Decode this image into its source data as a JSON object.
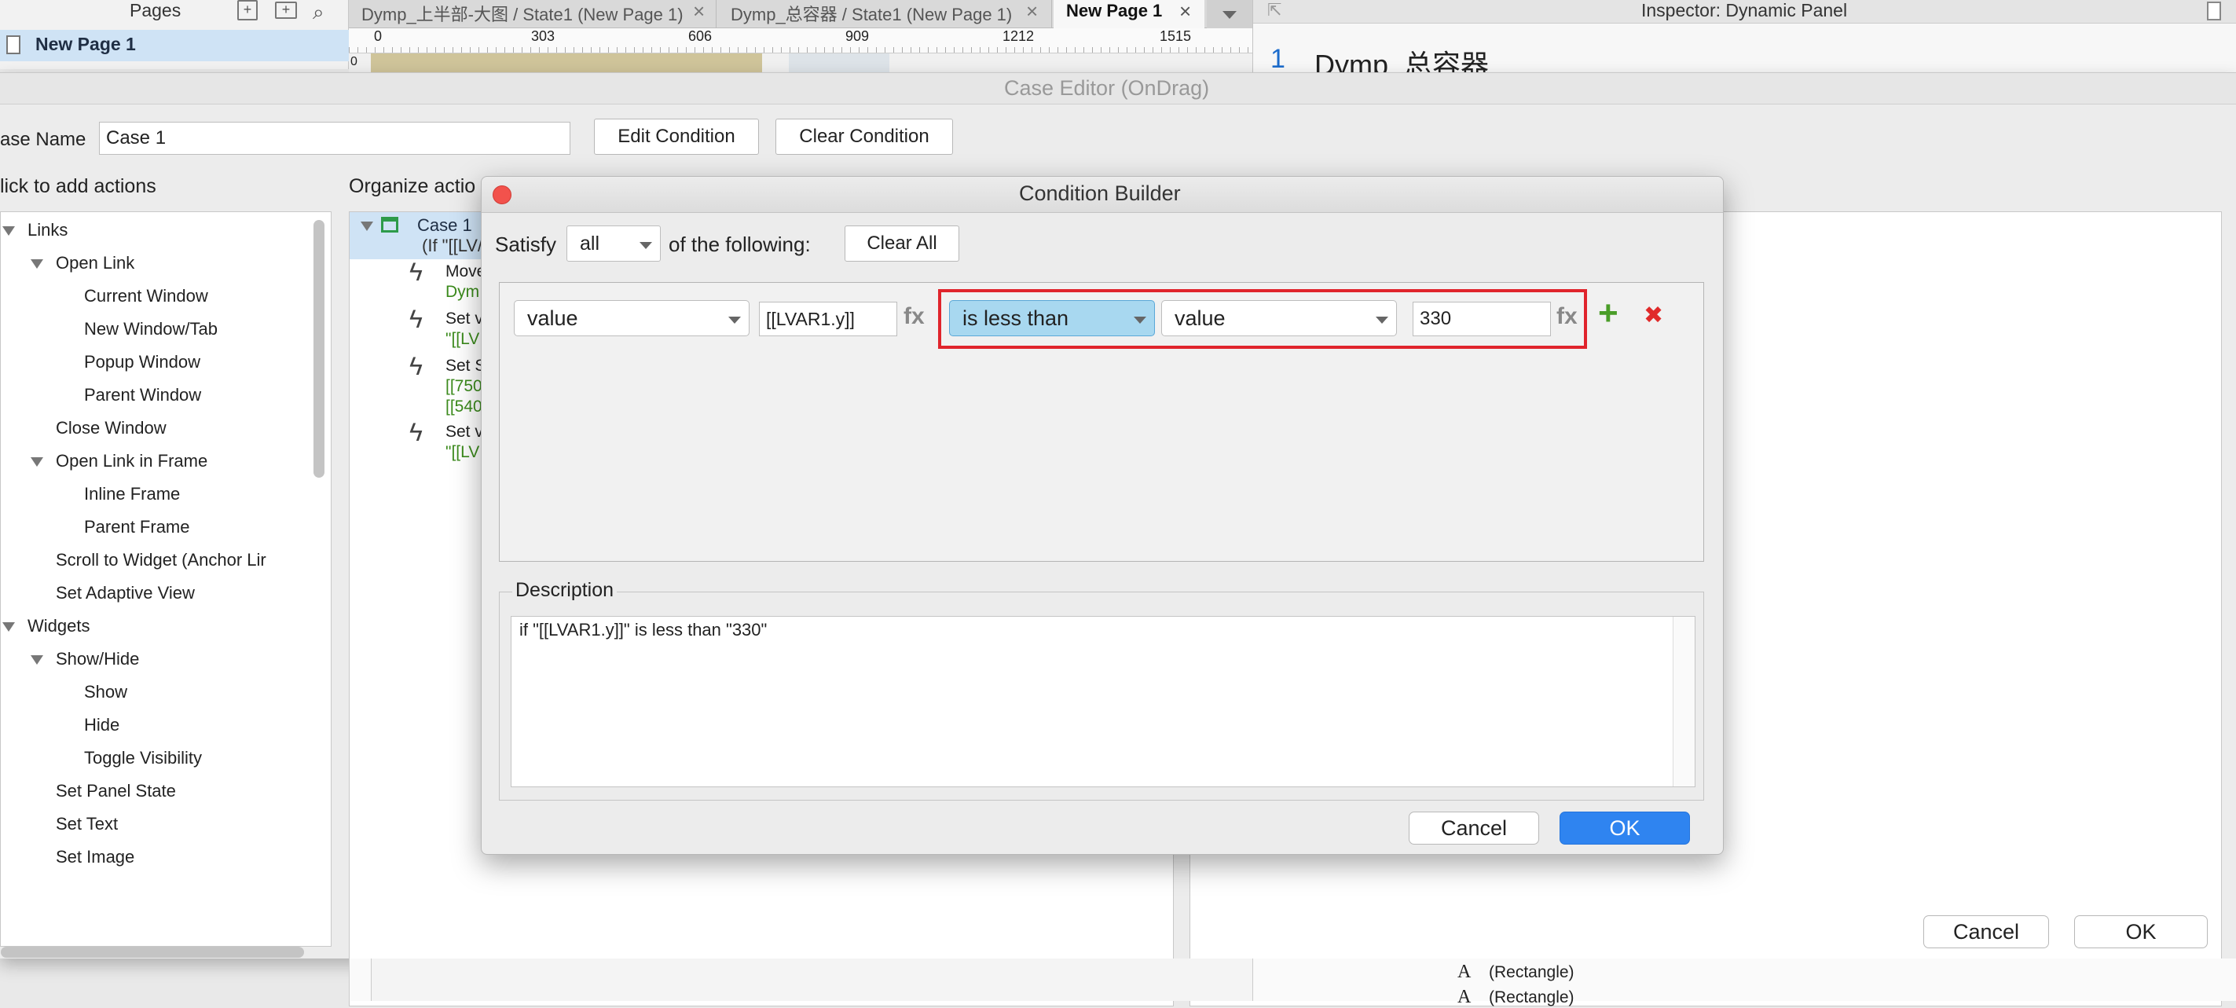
{
  "pages_panel": {
    "title": "Pages",
    "selected_page": "New Page 1"
  },
  "tabs": [
    {
      "label": "Dymp_上半部-大图 / State1 (New Page 1)",
      "close": "×"
    },
    {
      "label": "Dymp_总容器 / State1 (New Page 1)",
      "close": "×"
    },
    {
      "label": "New Page 1",
      "close": "×"
    }
  ],
  "ruler": {
    "ticks": [
      "0",
      "303",
      "606",
      "909",
      "1212",
      "1515"
    ],
    "vtick": "0"
  },
  "inspector": {
    "title": "Inspector: Dynamic Panel",
    "index": "1",
    "panel_name": "Dymp_总容器",
    "items": [
      {
        "glyph": "A",
        "label": "(Rectangle)"
      },
      {
        "glyph": "A",
        "label": "(Rectangle)"
      }
    ]
  },
  "case_editor": {
    "title": "Case Editor (OnDrag)",
    "case_name_label": "ase Name",
    "case_name_value": "Case 1",
    "edit_condition": "Edit Condition",
    "clear_condition": "Clear Condition",
    "add_actions_label": "lick to add actions",
    "organize_label": "Organize actio",
    "cancel": "Cancel",
    "ok": "OK",
    "actions_tree": [
      {
        "label": "Links",
        "level": 0,
        "expanded": true
      },
      {
        "label": "Open Link",
        "level": 1,
        "expanded": true
      },
      {
        "label": "Current Window",
        "level": 2
      },
      {
        "label": "New Window/Tab",
        "level": 2
      },
      {
        "label": "Popup Window",
        "level": 2
      },
      {
        "label": "Parent Window",
        "level": 2
      },
      {
        "label": "Close Window",
        "level": 1
      },
      {
        "label": "Open Link in Frame",
        "level": 1,
        "expanded": true
      },
      {
        "label": "Inline Frame",
        "level": 2
      },
      {
        "label": "Parent Frame",
        "level": 2
      },
      {
        "label": "Scroll to Widget (Anchor Lir",
        "level": 1
      },
      {
        "label": "Set Adaptive View",
        "level": 1
      },
      {
        "label": "Widgets",
        "level": 0,
        "expanded": true
      },
      {
        "label": "Show/Hide",
        "level": 1,
        "expanded": true
      },
      {
        "label": "Show",
        "level": 2
      },
      {
        "label": "Hide",
        "level": 2
      },
      {
        "label": "Toggle Visibility",
        "level": 2
      },
      {
        "label": "Set Panel State",
        "level": 1
      },
      {
        "label": "Set Text",
        "level": 1
      },
      {
        "label": "Set Image",
        "level": 1
      }
    ],
    "organize": {
      "case_label": "Case 1",
      "case_condition": "(If \"[[LV/",
      "actions": [
        {
          "line1": "Move",
          "line2": "Dym"
        },
        {
          "line1": "Set v",
          "line2": "\"[[LV"
        },
        {
          "line1": "Set S",
          "line2": "[[750",
          "line3": "[[540"
        },
        {
          "line1": "Set v",
          "line2": "\"[[LV"
        }
      ]
    }
  },
  "condition_builder": {
    "title": "Condition Builder",
    "satisfy_label": "Satisfy",
    "satisfy_value": "all",
    "following_label": "of the following:",
    "clear_all": "Clear All",
    "row": {
      "left_type": "value",
      "left_value": "[[LVAR1.y]]",
      "fx": "fx",
      "operator": "is less than",
      "right_type": "value",
      "right_value": "330",
      "fx2": "fx",
      "add": "+",
      "remove": "✖"
    },
    "description_label": "Description",
    "description_text": "if \"[[LVAR1.y]]\" is less than \"330\"",
    "cancel": "Cancel",
    "ok": "OK"
  },
  "colors": {
    "highlight_box": "#e0242c",
    "operator_bg": "#a8d8f0",
    "ok_blue": "#2f84f0",
    "add_green": "#4a9d28",
    "remove_red": "#e02a2a"
  }
}
